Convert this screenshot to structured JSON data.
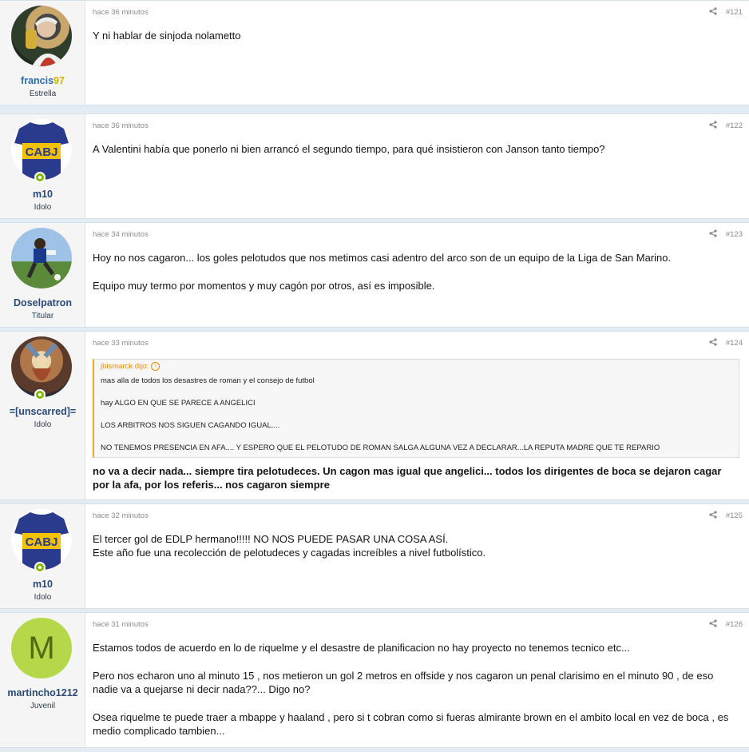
{
  "posts": [
    {
      "username_a": "francis",
      "username_b": "97",
      "title": "Estrella",
      "time": "hace 36 minutos",
      "num": "#121",
      "paragraphs": [
        "Y ni hablar de sinjoda nolametto"
      ]
    },
    {
      "username": "m10",
      "title": "Idolo",
      "time": "hace 36 minutos",
      "num": "#122",
      "avatar_text": "CABJ",
      "paragraphs": [
        "A Valentini había que ponerlo ni bien arrancó el segundo tiempo, para qué insistieron con Janson tanto tiempo?"
      ]
    },
    {
      "username": "Doselpatron",
      "title": "Titular",
      "time": "hace 34 minutos",
      "num": "#123",
      "paragraphs": [
        "Hoy no nos cagaron... los goles pelotudos que nos metimos casi adentro del arco son de un equipo de la Liga de San Marino.",
        "Equipo muy termo por momentos y muy cagón por otros, así es imposible."
      ]
    },
    {
      "username": "=[unscarred]=",
      "title": "Idolo",
      "time": "hace 33 minutos",
      "num": "#124",
      "quote_author": "jbismarck dijo:",
      "quote_lines": [
        "mas alla de todos los desastres de roman y el consejo de futbol",
        "hay ALGO EN QUE SE PARECE A ANGELICI",
        "LOS ARBITROS NOS SIGUEN CAGANDO IGUAL....",
        "NO TENEMOS PRESENCIA EN AFA.... Y ESPERO QUE EL PELOTUDO DE ROMAN SALGA ALGUNA VEZ A DECLARAR...LA REPUTA MADRE QUE TE REPARIO"
      ],
      "reply": "no va a decir nada... siempre tira pelotudeces. Un cagon mas igual que angelici... todos los dirigentes de boca se dejaron cagar por la afa, por los referis... nos cagaron siempre"
    },
    {
      "username": "m10",
      "title": "Idolo",
      "time": "hace 32 minutos",
      "num": "#125",
      "avatar_text": "CABJ",
      "lines": [
        "El tercer gol de EDLP hermano!!!!! NO NOS PUEDE PASAR UNA COSA ASÍ.",
        "Este año fue una recolección de pelotudeces y cagadas increíbles a nivel futbolístico."
      ]
    },
    {
      "username": "martincho1212",
      "title": "Juvenil",
      "time": "hace 31 minutos",
      "num": "#126",
      "avatar_letter": "M",
      "paragraphs": [
        "Estamos todos de acuerdo en lo de riquelme y el desastre de planificacion no hay proyecto no tenemos tecnico etc...",
        "Pero nos echaron uno al minuto 15 , nos metieron un gol 2 metros en offside y nos cagaron un penal clarisimo en el minuto 90 , de eso nadie va a quejarse ni decir nada??... Digo no?",
        "Osea riquelme te puede traer a mbappe y haaland , pero si t cobran como si fueras almirante brown en el ambito local en vez de boca , es medio complicado tambien..."
      ]
    }
  ],
  "colors": {
    "accent": "#f08c00",
    "username": "#2a4a7a",
    "online": "#7fb900",
    "avatar_m": "#b5d84a"
  }
}
